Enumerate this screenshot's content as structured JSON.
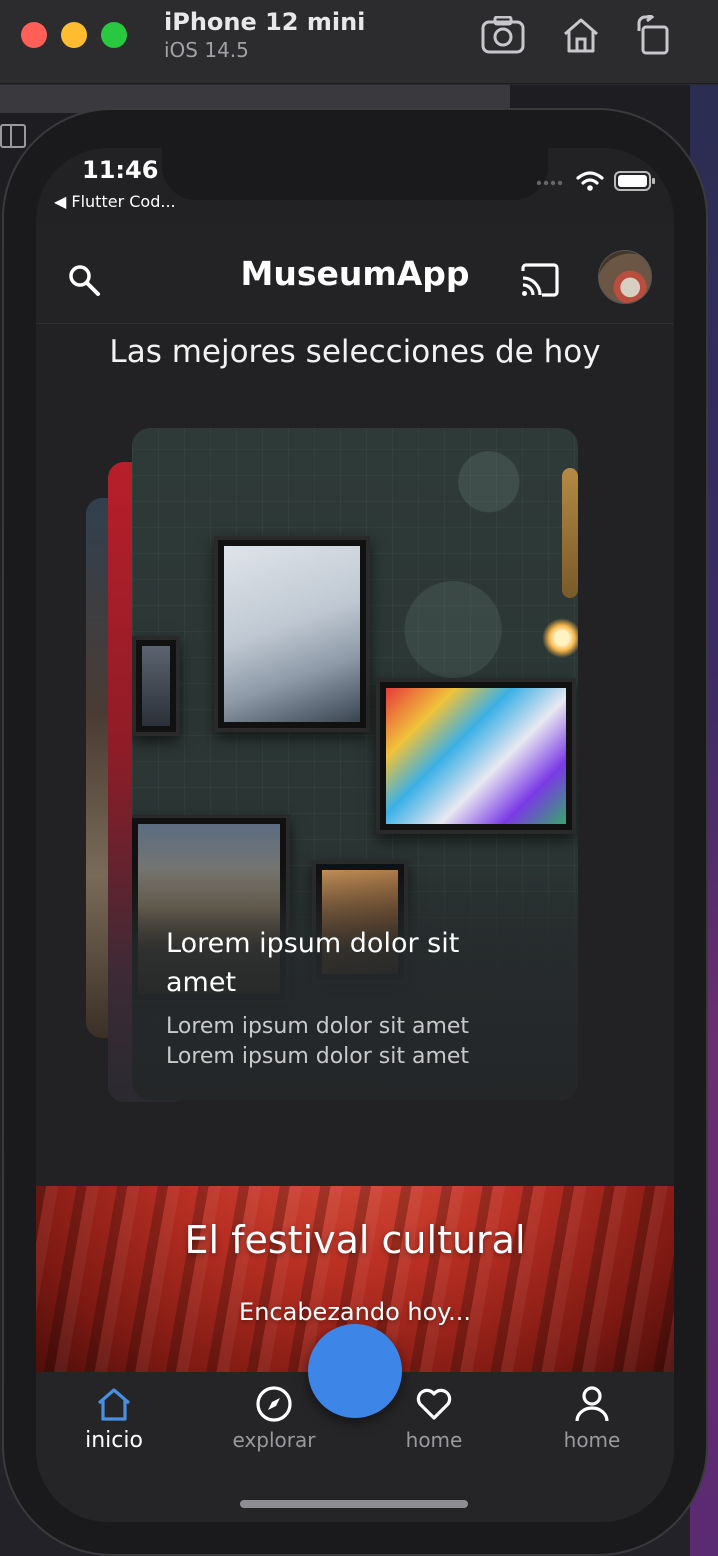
{
  "simulator": {
    "device_name": "iPhone 12 mini",
    "os_version": "iOS 14.5",
    "toolbar_icons": [
      "screenshot-icon",
      "home-icon",
      "rotate-icon"
    ]
  },
  "status_bar": {
    "time": "11:46",
    "back_app": "◀ Flutter Cod..."
  },
  "header": {
    "title": "MuseumApp",
    "icons": [
      "search-icon",
      "cast-icon"
    ]
  },
  "section_heading": "Las mejores selecciones de hoy",
  "featured_card": {
    "title": "Lorem ipsum dolor sit amet",
    "subtitle": "Lorem ipsum dolor sit amet\nLorem  ipsum dolor sit amet"
  },
  "banner": {
    "title": "El festival cultural",
    "subtitle": "Encabezando hoy..."
  },
  "bottom_nav": {
    "items": [
      {
        "label": "inicio",
        "icon": "home-outline-icon",
        "active": true
      },
      {
        "label": "explorar",
        "icon": "compass-icon",
        "active": false
      },
      {
        "label": "home",
        "icon": "heart-icon",
        "active": false
      },
      {
        "label": "home",
        "icon": "person-icon",
        "active": false
      }
    ]
  },
  "colors": {
    "accent": "#3d86e8",
    "background": "#222224",
    "nav_active": "#4a90e2"
  }
}
